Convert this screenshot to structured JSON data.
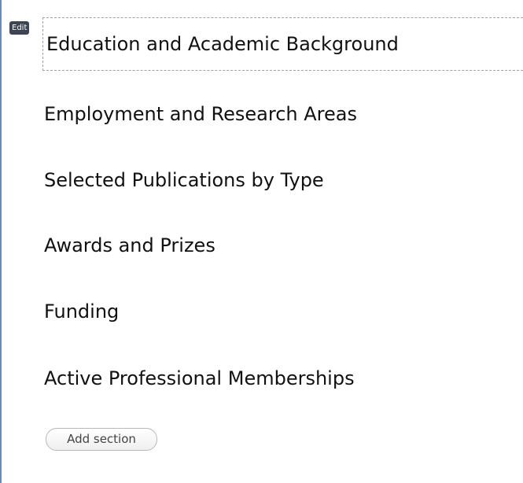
{
  "editor": {
    "edit_badge": "Edit",
    "sections": [
      {
        "title": "Education and Academic Background"
      },
      {
        "title": "Employment and Research Areas"
      },
      {
        "title": "Selected Publications by Type"
      },
      {
        "title": "Awards and Prizes"
      },
      {
        "title": "Funding"
      },
      {
        "title": "Active Professional Memberships"
      }
    ],
    "add_section_label": "Add section",
    "colors": {
      "panel_border": "#6d89b5",
      "edit_badge_bg": "#3d4452",
      "selection_border": "#9aa3ad"
    }
  }
}
